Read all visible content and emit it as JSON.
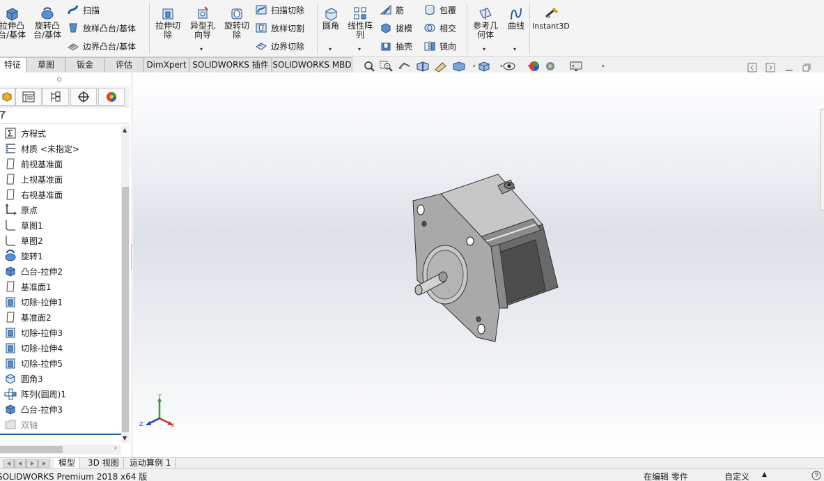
{
  "ribbon": {
    "extrude_boss": "拉伸凸\n台/基体",
    "revolve_boss": "旋转凸\n台/基体",
    "sweep": "扫描",
    "loft_boss": "放样凸台/基体",
    "boundary_boss": "边界凸台/基体",
    "extrude_cut": "拉伸切\n除",
    "hole_wizard": "异型孔\n向导",
    "revolve_cut": "旋转切\n除",
    "swept_cut": "扫描切除",
    "lofted_cut": "放样切割",
    "boundary_cut": "边界切除",
    "fillet": "圆角",
    "linear_pattern": "线性阵\n列",
    "rib": "筋",
    "draft": "拔模",
    "shell": "抽壳",
    "wrap": "包覆",
    "intersect": "相交",
    "mirror": "镜向",
    "reference_geometry": "参考几\n何体",
    "curves": "曲线",
    "instant3d": "Instant3D"
  },
  "tabs": [
    "特征",
    "草图",
    "钣金",
    "评估",
    "DimXpert",
    "SOLIDWORKS 插件",
    "SOLIDWORKS MBD"
  ],
  "active_tab": "特征",
  "tree": [
    {
      "label": "方程式",
      "icon": "equations-icon"
    },
    {
      "label": "材质 <未指定>",
      "icon": "material-icon"
    },
    {
      "label": "前视基准面",
      "icon": "plane-icon"
    },
    {
      "label": "上视基准面",
      "icon": "plane-icon"
    },
    {
      "label": "右视基准面",
      "icon": "plane-icon"
    },
    {
      "label": "原点",
      "icon": "origin-icon"
    },
    {
      "label": "草图1",
      "icon": "sketch-icon"
    },
    {
      "label": "草图2",
      "icon": "sketch-icon"
    },
    {
      "label": "旋转1",
      "icon": "revolve-icon"
    },
    {
      "label": "凸台-拉伸2",
      "icon": "extrude-icon"
    },
    {
      "label": "基准面1",
      "icon": "plane-icon"
    },
    {
      "label": "切除-拉伸1",
      "icon": "cut-icon"
    },
    {
      "label": "基准面2",
      "icon": "plane-icon"
    },
    {
      "label": "切除-拉伸3",
      "icon": "cut-icon"
    },
    {
      "label": "切除-拉伸4",
      "icon": "cut-icon"
    },
    {
      "label": "切除-拉伸5",
      "icon": "cut-icon"
    },
    {
      "label": "圆角3",
      "icon": "fillet-icon"
    },
    {
      "label": "阵列(圆周)1",
      "icon": "pattern-icon"
    },
    {
      "label": "凸台-拉伸3",
      "icon": "extrude-icon"
    },
    {
      "label": "双轴",
      "icon": "folder-icon"
    }
  ],
  "bottom_tabs": [
    "模型",
    "3D 视图",
    "运动算例 1"
  ],
  "status": {
    "app": "SOLIDWORKS Premium 2018 x64 版",
    "mode": "在编辑 零件",
    "custom": "自定义"
  },
  "triad": {
    "x": "X",
    "y": "Y",
    "z": "Z"
  },
  "colors": {
    "ribbon_bg": "#f4f4f4",
    "accent_blue": "#1f5fa8",
    "model_gray": "#9b9b9b"
  }
}
